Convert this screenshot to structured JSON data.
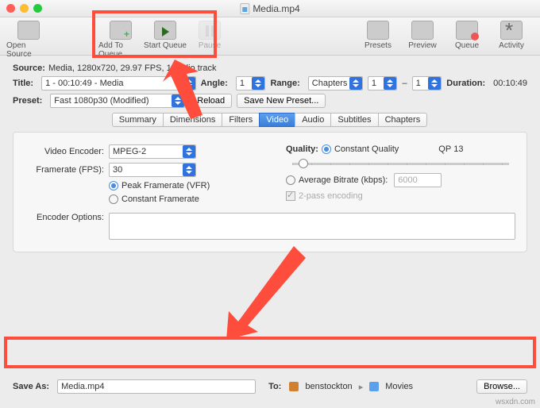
{
  "window": {
    "title": "Media.mp4"
  },
  "toolbar": {
    "open_source": "Open Source",
    "add_to_queue": "Add To Queue",
    "start_queue": "Start Queue",
    "pause": "Pause",
    "presets": "Presets",
    "preview": "Preview",
    "queue": "Queue",
    "activity": "Activity"
  },
  "source": {
    "label": "Source:",
    "value": "Media, 1280x720, 29.97 FPS, 1 audio track"
  },
  "title_row": {
    "label": "Title:",
    "value": "1 - 00:10:49 - Media",
    "angle_label": "Angle:",
    "angle_value": "1",
    "range_label": "Range:",
    "range_value": "Chapters",
    "range_from": "1",
    "range_sep": "–",
    "range_to": "1",
    "duration_label": "Duration:",
    "duration_value": "00:10:49"
  },
  "preset_row": {
    "label": "Preset:",
    "value": "Fast 1080p30 (Modified)",
    "reload": "Reload",
    "save_new": "Save New Preset..."
  },
  "tabs": [
    "Summary",
    "Dimensions",
    "Filters",
    "Video",
    "Audio",
    "Subtitles",
    "Chapters"
  ],
  "tabs_active_index": 3,
  "video_panel": {
    "encoder_label": "Video Encoder:",
    "encoder_value": "MPEG-2",
    "fps_label": "Framerate (FPS):",
    "fps_value": "30",
    "peak_vfr": "Peak Framerate (VFR)",
    "constant_fr": "Constant Framerate",
    "quality_label": "Quality:",
    "const_quality": "Constant Quality",
    "qp_label": "QP",
    "qp_value": "13",
    "avg_bitrate": "Average Bitrate (kbps):",
    "avg_bitrate_value": "6000",
    "twopass": "2-pass encoding",
    "encopts_label": "Encoder Options:"
  },
  "footer": {
    "saveas_label": "Save As:",
    "saveas_value": "Media.mp4",
    "to_label": "To:",
    "path_user": "benstockton",
    "path_folder": "Movies",
    "browse": "Browse..."
  },
  "watermark": "wsxdn.com"
}
